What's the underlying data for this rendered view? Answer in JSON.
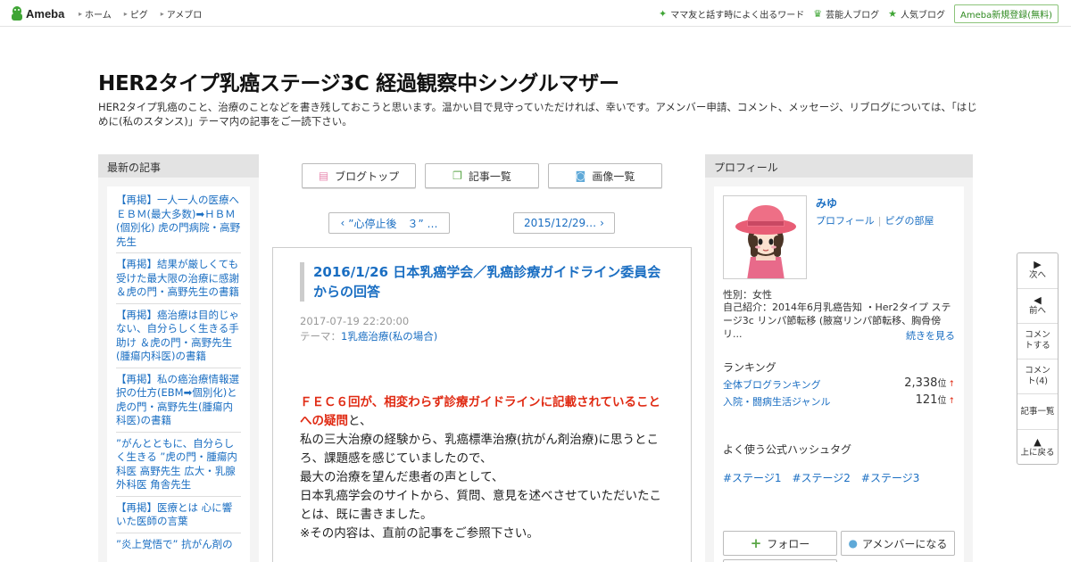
{
  "header": {
    "logo_text": "Ameba",
    "nav": [
      "ホーム",
      "ピグ",
      "アメブロ"
    ],
    "right_links": [
      {
        "label": "ママ友と話す時によく出るワード",
        "icon": "sparkle-icon"
      },
      {
        "label": "芸能人ブログ",
        "icon": "crown-icon"
      },
      {
        "label": "人気ブログ",
        "icon": "star-icon"
      }
    ],
    "signup_label": "Ameba新規登録(無料)"
  },
  "blog": {
    "title": "HER2タイプ乳癌ステージ3C 経過観察中シングルマザー",
    "description": "HER2タイプ乳癌のこと、治療のことなどを書き残しておこうと思います。温かい目で見守っていただければ、幸いです。アメンバー申請、コメント、メッセージ、リブログについては、「はじめに(私のスタンス)」テーマ内の記事をご一読下さい。"
  },
  "left_sidebar": {
    "heading": "最新の記事",
    "items": [
      "【再掲】一人一人の医療へ ＥＢＭ(最大多数)➡ＨＢＭ(個別化) 虎の門病院・高野先生",
      "【再掲】結果が厳しくても受けた最大限の治療に感謝 ＆虎の門・高野先生の書籍",
      "【再掲】癌治療は目的じゃない、自分らしく生きる手助け ＆虎の門・高野先生(腫瘍内科医)の書籍",
      "【再掲】私の癌治療情報選択の仕方(EBM➡個別化)と虎の門・高野先生(腫瘍内科医)の書籍",
      "”がんとともに、自分らしく生きる ”虎の門・腫瘍内科医 高野先生 広大・乳腺外科医 角舎先生",
      "【再掲】医療とは 心に響いた医師の言葉",
      "”炎上覚悟で” 抗がん剤の"
    ]
  },
  "tabs": [
    {
      "label": "ブログトップ",
      "icon": "document-icon"
    },
    {
      "label": "記事一覧",
      "icon": "copy-icon"
    },
    {
      "label": "画像一覧",
      "icon": "camera-icon"
    }
  ],
  "pager": {
    "prev_label": "”心停止後　３” …",
    "next_label": "2015/12/29…"
  },
  "article": {
    "title": "2016/1/26 日本乳癌学会／乳癌診療ガイドライン委員会からの回答",
    "date": "2017-07-19 22:20:00",
    "theme_prefix": "テーマ：",
    "theme": "1乳癌治療(私の場合)",
    "body_red": "ＦＥＣ６回が、相変わらず診療ガイドラインに記載されていることへの疑問",
    "body_red_tail": "と、",
    "body_lines": [
      "私の三大治療の経験から、乳癌標準治療(抗がん剤治療)に思うところ、課題感を感じていましたので、",
      "最大の治療を望んだ患者の声として、",
      "日本乳癌学会のサイトから、質問、意見を述べさせていただいたことは、既に書きました。",
      "※その内容は、直前の記事をご参照下さい。"
    ]
  },
  "profile": {
    "heading": "プロフィール",
    "name": "みゆ",
    "link_profile": "プロフィール",
    "link_room": "ピグの部屋",
    "gender": "性別：女性",
    "intro": "自己紹介：2014年6月乳癌告知 ・Her2タイプ ステージ3c リンパ節転移 (腋窩リンパ節転移、胸骨傍リ...",
    "more": "続きを見る",
    "ranking_heading": "ランキング",
    "rankings": [
      {
        "label": "全体ブログランキング",
        "value": "2,338",
        "unit": "位",
        "trend": "↑"
      },
      {
        "label": "入院・闘病生活ジャンル",
        "value": "121",
        "unit": "位",
        "trend": "↑"
      }
    ],
    "hashtag_heading": "よく使う公式ハッシュタグ",
    "hashtags": [
      "#ステージ1",
      "#ステージ2",
      "#ステージ3"
    ],
    "follow_label": "フォロー",
    "member_label": "アメンバーになる"
  },
  "float_nav": [
    {
      "arrow": "▶",
      "label": "次へ"
    },
    {
      "arrow": "◀",
      "label": "前へ"
    },
    {
      "arrow": "",
      "label": "コメントする"
    },
    {
      "arrow": "",
      "label": "コメント(4)"
    },
    {
      "arrow": "",
      "label": "記事一覧"
    },
    {
      "arrow": "▲",
      "label": "上に戻る"
    }
  ]
}
